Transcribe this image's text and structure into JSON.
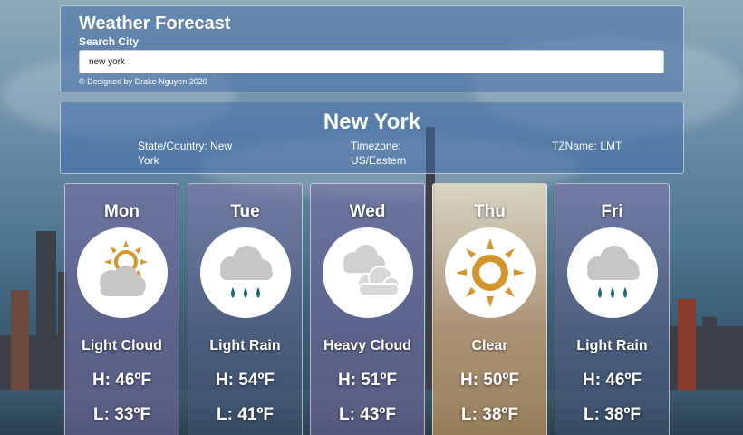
{
  "header": {
    "title": "Weather Forecast",
    "search_label": "Search City",
    "search_value": "new york",
    "credit": "© Designed by Drake Nguyen 2020"
  },
  "city": {
    "name": "New York",
    "state_country": "State/Country: New York",
    "timezone": "Timezone: US/Eastern",
    "tzname": "TZName: LMT"
  },
  "forecast": [
    {
      "day": "Mon",
      "condition": "Light Cloud",
      "high": "H: 46ºF",
      "low": "L: 33ºF",
      "icon": "light-cloud-icon"
    },
    {
      "day": "Tue",
      "condition": "Light Rain",
      "high": "H: 54ºF",
      "low": "L: 41ºF",
      "icon": "light-rain-icon"
    },
    {
      "day": "Wed",
      "condition": "Heavy Cloud",
      "high": "H: 51ºF",
      "low": "L: 43ºF",
      "icon": "heavy-cloud-icon"
    },
    {
      "day": "Thu",
      "condition": "Clear",
      "high": "H: 50ºF",
      "low": "L: 38ºF",
      "icon": "sun-icon"
    },
    {
      "day": "Fri",
      "condition": "Light Rain",
      "high": "H: 46ºF",
      "low": "L: 38ºF",
      "icon": "light-rain-icon"
    }
  ],
  "colors": {
    "sun": "#d4952e",
    "cloud": "#c6c6c6",
    "rain_drop": "#1d6b7a"
  }
}
